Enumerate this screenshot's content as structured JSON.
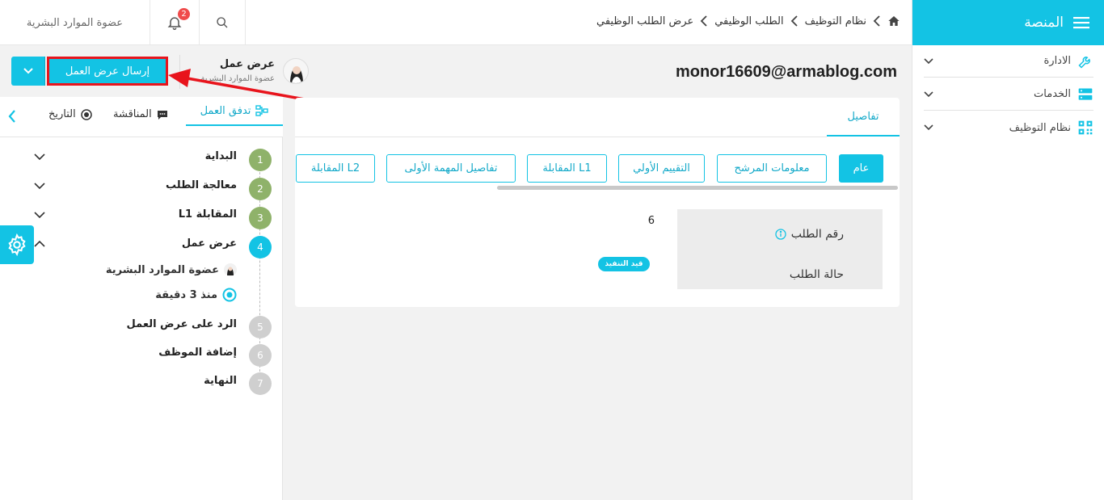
{
  "sidebar": {
    "title": "المنصة",
    "items": [
      {
        "label": "الادارة"
      },
      {
        "label": "الخدمات"
      },
      {
        "label": "نظام التوظيف"
      }
    ]
  },
  "topbar": {
    "breadcrumb": [
      "نظام التوظيف",
      "الطلب الوظيفي",
      "عرض الطلب الوظيفي"
    ],
    "user_role": "عضوة الموارد البشرية",
    "notification_count": "2"
  },
  "header": {
    "email": "monor16609@armablog.com",
    "stage_title": "عرض عمل",
    "stage_subtitle": "عضوة الموارد البشرية",
    "send_offer_label": "إرسال عرض العمل"
  },
  "left_tabs": {
    "workflow": "تدفق العمل",
    "discussion": "المناقشة",
    "history": "التاريخ"
  },
  "workflow": {
    "steps": [
      {
        "num": "1",
        "label": "البداية",
        "status": "done"
      },
      {
        "num": "2",
        "label": "معالجة الطلب",
        "status": "done"
      },
      {
        "num": "3",
        "label": "المقابلة L1",
        "status": "done"
      },
      {
        "num": "4",
        "label": "عرض عمل",
        "status": "current"
      },
      {
        "num": "5",
        "label": "الرد على عرض العمل",
        "status": "todo"
      },
      {
        "num": "6",
        "label": "إضافة الموظف",
        "status": "todo"
      },
      {
        "num": "7",
        "label": "النهاية",
        "status": "todo"
      }
    ],
    "current_assignee": "عضوة الموارد البشرية",
    "current_time": "منذ 3 دقيقة"
  },
  "main": {
    "details_tab": "تفاصيل",
    "pills": [
      "عام",
      "معلومات المرشح",
      "التقييم الأولي",
      "المقابلة L1",
      "تفاصيل المهمة الأولى",
      "المقابلة L2"
    ],
    "request_number_label": "رقم الطلب",
    "request_number_value": "6",
    "request_status_label": "حالة الطلب",
    "request_status_value": "قيد التنفيذ"
  },
  "colors": {
    "accent": "#13c3e4",
    "done": "#8fb26a",
    "todo": "#cfcfcf",
    "arrow": "#e8141c"
  }
}
